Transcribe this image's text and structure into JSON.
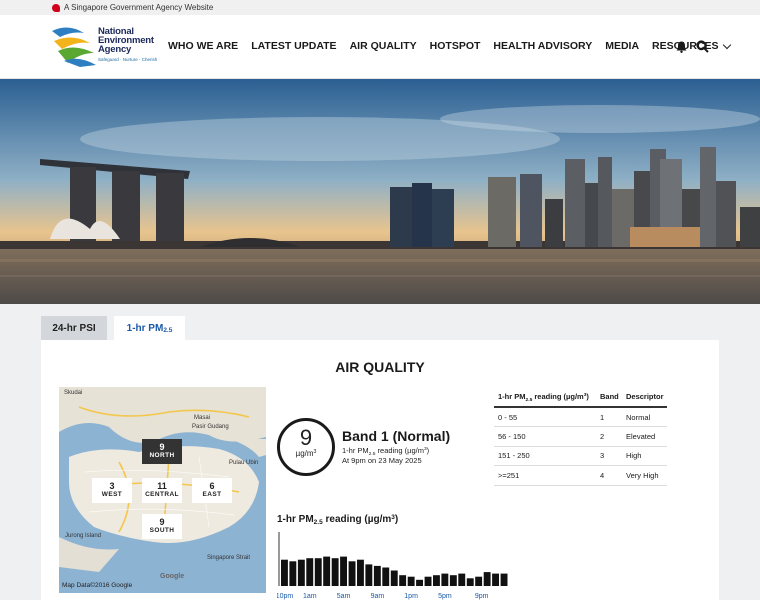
{
  "gov_bar": {
    "text": "A Singapore Government Agency Website"
  },
  "logo": {
    "line1": "National",
    "line2": "Environment",
    "line3": "Agency",
    "tagline": "Safeguard · Nurture · Cherish"
  },
  "nav": {
    "items": [
      "WHO WE ARE",
      "LATEST UPDATE",
      "AIR QUALITY",
      "HOTSPOT",
      "HEALTH ADVISORY",
      "MEDIA"
    ],
    "resources": "RESOURCES"
  },
  "tabs": {
    "psi": "24-hr PSI",
    "pm": "1-hr PM2.5"
  },
  "section_title": "AIR QUALITY",
  "map": {
    "labels": {
      "skudai": "Skudai",
      "masai": "Masai",
      "pasir": "Pasir Gudang",
      "pulau": "Pulau Ubin",
      "jurong": "Jurong Island",
      "strait": "Singapore Strait"
    },
    "regions": [
      {
        "name": "NORTH",
        "value": "9"
      },
      {
        "name": "WEST",
        "value": "3"
      },
      {
        "name": "CENTRAL",
        "value": "11"
      },
      {
        "name": "EAST",
        "value": "6"
      },
      {
        "name": "SOUTH",
        "value": "9"
      }
    ],
    "attribution": "Map Data©2016 Google",
    "google": "Google"
  },
  "reading": {
    "value": "9",
    "band": "Band 1 (Normal)",
    "time": "At 9pm on 23 May 2025"
  },
  "table": {
    "headers": {
      "band": "Band",
      "descriptor": "Descriptor"
    },
    "rows": [
      {
        "range": "0 - 55",
        "band": "1",
        "descriptor": "Normal"
      },
      {
        "range": "56 - 150",
        "band": "2",
        "descriptor": "Elevated"
      },
      {
        "range": "151 - 250",
        "band": "3",
        "descriptor": "High"
      },
      {
        "range": ">=251",
        "band": "4",
        "descriptor": "Very High"
      }
    ]
  },
  "chart_data": {
    "type": "bar",
    "title": "1-hr PM2.5 reading (µg/m³)",
    "x_tick_labels": [
      "10pm",
      "1am",
      "5am",
      "9am",
      "1pm",
      "5pm",
      "9pm"
    ],
    "values": [
      17,
      16,
      17,
      18,
      18,
      19,
      18,
      19,
      16,
      17,
      14,
      13,
      12,
      10,
      7,
      6,
      4,
      6,
      7,
      8,
      7,
      8,
      5,
      6,
      9,
      8,
      8
    ],
    "ylim": [
      0,
      22
    ],
    "bar_color": "#111111"
  }
}
